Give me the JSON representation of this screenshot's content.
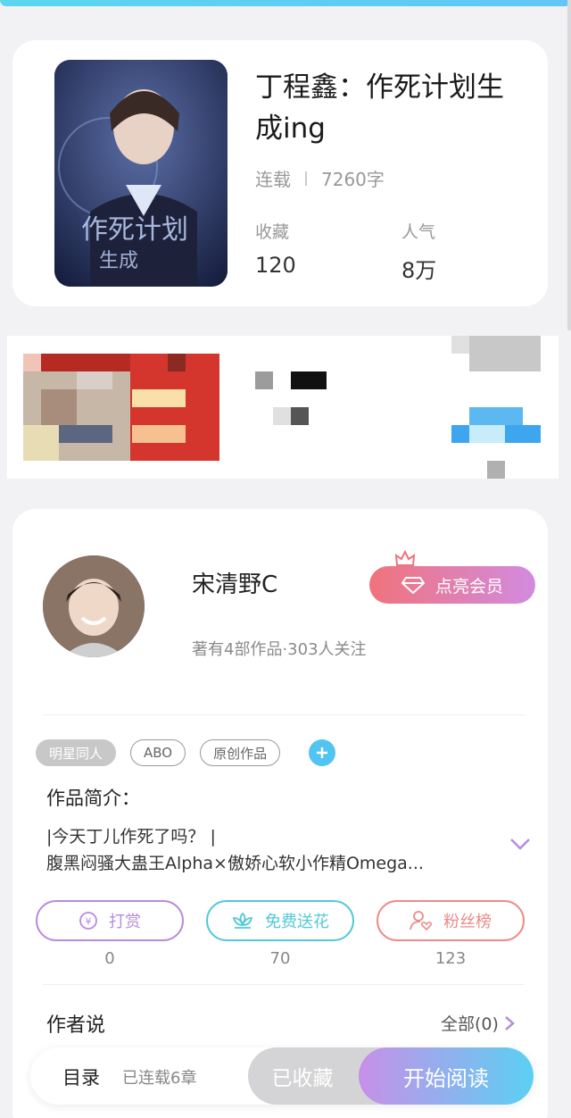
{
  "book": {
    "title": "丁程鑫：作死计划生成ing",
    "status": "连载",
    "word_count": "7260字",
    "stats": [
      {
        "label": "收藏",
        "value": "120"
      },
      {
        "label": "人气",
        "value": "8万"
      }
    ]
  },
  "author": {
    "name": "宋清野C",
    "stats": "著有4部作品·303人关注",
    "vip_label": "点亮会员"
  },
  "tags": [
    "明星同人",
    "ABO",
    "原创作品"
  ],
  "intro": {
    "label": "作品简介：",
    "line1": "|今天丁儿作死了吗？ |",
    "line2": "腹黑闷骚大蛊王Alpha×傲娇心软小作精Omega..."
  },
  "actions": [
    {
      "label": "打赏",
      "count": "0",
      "color": "#b98bdc"
    },
    {
      "label": "免费送花",
      "count": "70",
      "color": "#52c9d6"
    },
    {
      "label": "粉丝榜",
      "count": "123",
      "color": "#ee8a8a"
    }
  ],
  "author_says": {
    "label": "作者说",
    "all_label": "全部(0)"
  },
  "bottom": {
    "toc_label": "目录",
    "chapters_label": "已连载6章",
    "collected_label": "已收藏",
    "read_label": "开始阅读"
  },
  "colors": {
    "accent_blue": "#52c4f2",
    "vip_gradient_start": "#f0737c",
    "vip_gradient_end": "#d28be0"
  }
}
